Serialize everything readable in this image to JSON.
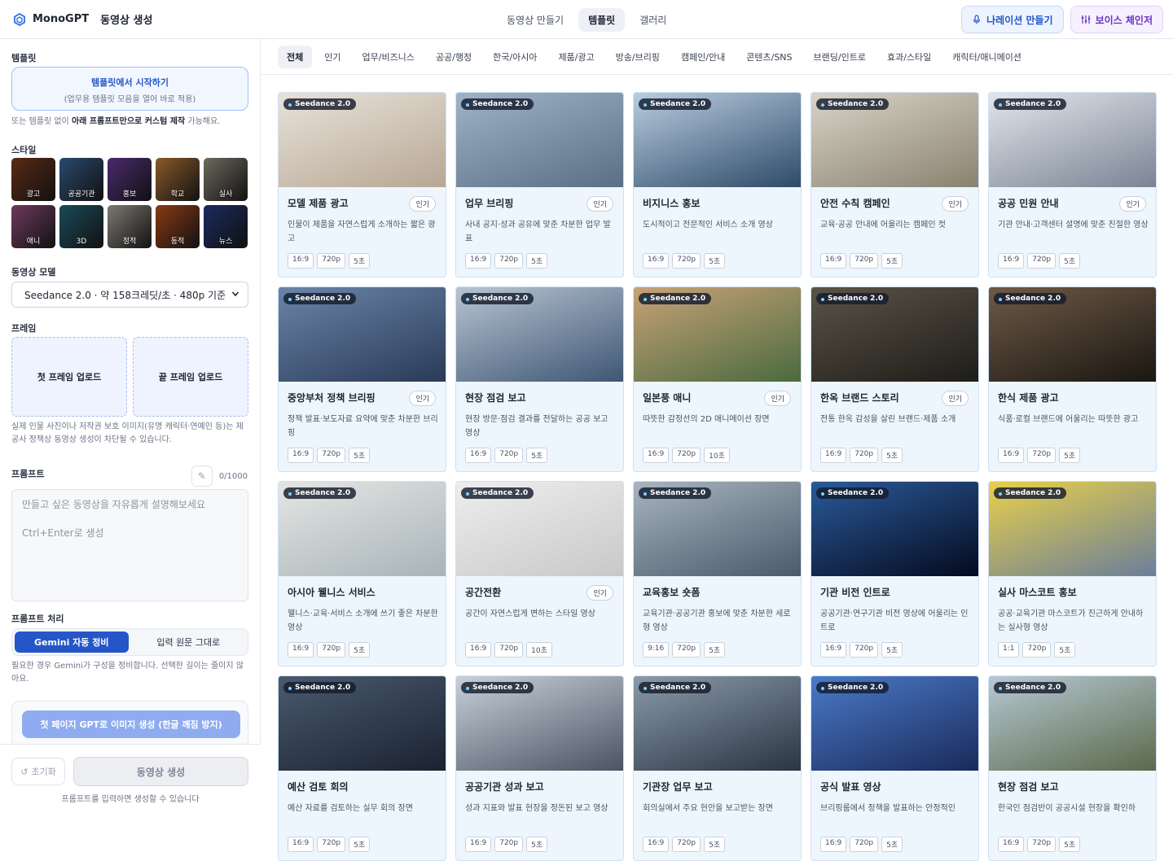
{
  "app": {
    "brand": "MonoGPT",
    "page": "동영상 생성"
  },
  "nav": {
    "tabs": [
      "동영상 만들기",
      "템플릿",
      "갤러리"
    ],
    "active": 1
  },
  "actions": {
    "narration": "나레이션 만들기",
    "voice": "보이스 체인저"
  },
  "sidebar": {
    "template_label": "템플릿",
    "template_start": "템플릿에서 시작하기",
    "template_start_sub": "(업무용 템플릿 모음을 열어 바로 적용)",
    "template_hint_pre": "또는 템플릿 없이 ",
    "template_hint_bold": "아래 프롬프트만으로 커스텀 제작",
    "template_hint_post": " 가능해요.",
    "style_label": "스타일",
    "styles": [
      {
        "name": "광고",
        "color": "#5a2a14"
      },
      {
        "name": "공공기관",
        "color": "#2a4a6e"
      },
      {
        "name": "홍보",
        "color": "#4a2a6e"
      },
      {
        "name": "학교",
        "color": "#8a5a2a"
      },
      {
        "name": "실사",
        "color": "#6e6a5e"
      },
      {
        "name": "애니",
        "color": "#6e3a5e"
      },
      {
        "name": "3D",
        "color": "#1a4a5a"
      },
      {
        "name": "정적",
        "color": "#7e7a72"
      },
      {
        "name": "동적",
        "color": "#8a3a14"
      },
      {
        "name": "뉴스",
        "color": "#1a2a5e"
      }
    ],
    "model_label": "동영상 모델",
    "model_value": "Seedance 2.0 · 약 158크레딧/초 · 480p 기준",
    "frame_label": "프레임",
    "first_frame": "첫 프레임 업로드",
    "last_frame": "끝 프레임 업로드",
    "frame_hint": "실제 인물 사진이나 저작권 보호 이미지(유명 캐릭터·연예인 등)는 제공사 정책상 동영상 생성이 차단될 수 있습니다.",
    "prompt_label": "프롬프트",
    "prompt_count": "0/1000",
    "prompt_placeholder_1": "만들고 싶은 동영상을 자유롭게 설명해보세요",
    "prompt_placeholder_2": "Ctrl+Enter로 생성",
    "processing_label": "프롬프트 처리",
    "processing_options": [
      "Gemini 자동 정비",
      "입력 원문 그대로"
    ],
    "processing_active": 0,
    "processing_hint": "필요한 경우 Gemini가 구성을 정비합니다. 선택한 길이는 줄이지 않아요.",
    "gpt_button": "첫 페이지 GPT로 이미지 생성 (한글 깨짐 방지)",
    "reset": "초기화",
    "generate": "동영상 생성",
    "generate_hint": "프롬프트를 입력하면 생성할 수 있습니다"
  },
  "categories": [
    "전체",
    "인기",
    "업무/비즈니스",
    "공공/행정",
    "한국/아시아",
    "제품/광고",
    "방송/브리핑",
    "캠페인/안내",
    "콘텐츠/SNS",
    "브랜딩/인트로",
    "효과/스타일",
    "캐릭터/애니메이션"
  ],
  "category_active": 0,
  "model_badge": "Seedance 2.0",
  "hot_label": "인기",
  "cards": [
    {
      "title": "모델 제품 광고",
      "hot": true,
      "desc": "인물이 제품을 자연스럽게 소개하는 짧은 광고",
      "tags": [
        "16:9",
        "720p",
        "5초"
      ],
      "c1": "#e8e2da",
      "c2": "#b7a794"
    },
    {
      "title": "업무 브리핑",
      "hot": true,
      "desc": "사내 공지·성과 공유에 맞춘 차분한 업무 발표",
      "tags": [
        "16:9",
        "720p",
        "5초"
      ],
      "c1": "#9fb3c8",
      "c2": "#5a6e84"
    },
    {
      "title": "비지니스 홍보",
      "hot": false,
      "desc": "도시적이고 전문적인 서비스 소개 영상",
      "tags": [
        "16:9",
        "720p",
        "5초"
      ],
      "c1": "#b9cde0",
      "c2": "#2e4a68"
    },
    {
      "title": "안전 수칙 캠페인",
      "hot": true,
      "desc": "교육·공공 안내에 어울리는 캠페인 컷",
      "tags": [
        "16:9",
        "720p",
        "5초"
      ],
      "c1": "#d8d4c8",
      "c2": "#8a8270"
    },
    {
      "title": "공공 민원 안내",
      "hot": true,
      "desc": "기관 안내·고객센터 설명에 맞춘 친절한 영상",
      "tags": [
        "16:9",
        "720p",
        "5초"
      ],
      "c1": "#e2e6ec",
      "c2": "#7a8494"
    },
    {
      "title": "중앙부처 정책 브리핑",
      "hot": true,
      "desc": "정책 발표·보도자료 요약에 맞춘 차분한 브리핑",
      "tags": [
        "16:9",
        "720p",
        "5초"
      ],
      "c1": "#6a84a8",
      "c2": "#2a3a58"
    },
    {
      "title": "현장 점검 보고",
      "hot": false,
      "desc": "현장 방문·점검 결과를 전달하는 공공 보고 영상",
      "tags": [
        "16:9",
        "720p",
        "5초"
      ],
      "c1": "#b8c4d2",
      "c2": "#3e5674"
    },
    {
      "title": "일본풍 애니",
      "hot": true,
      "desc": "따뜻한 감정선의 2D 애니메이션 장면",
      "tags": [
        "16:9",
        "720p",
        "10초"
      ],
      "c1": "#c8a278",
      "c2": "#4a6a3e"
    },
    {
      "title": "한옥 브랜드 스토리",
      "hot": true,
      "desc": "전통 한옥 감성을 살린 브랜드·제품 소개",
      "tags": [
        "16:9",
        "720p",
        "5초"
      ],
      "c1": "#5a5448",
      "c2": "#1e1c18"
    },
    {
      "title": "한식 제품 광고",
      "hot": false,
      "desc": "식품·로컬 브랜드에 어울리는 따뜻한 광고",
      "tags": [
        "16:9",
        "720p",
        "5초"
      ],
      "c1": "#6e5a46",
      "c2": "#1a1612"
    },
    {
      "title": "아시아 웰니스 서비스",
      "hot": false,
      "desc": "웰니스·교육·서비스 소개에 쓰기 좋은 차분한 영상",
      "tags": [
        "16:9",
        "720p",
        "5초"
      ],
      "c1": "#e4e6e4",
      "c2": "#a8b4b8"
    },
    {
      "title": "공간전환",
      "hot": true,
      "desc": "공간이 자연스럽게 변하는 스타일 영상",
      "tags": [
        "16:9",
        "720p",
        "10초"
      ],
      "c1": "#eeeeee",
      "c2": "#c8c8c8"
    },
    {
      "title": "교육홍보 숏폼",
      "hot": false,
      "desc": "교육기관·공공기관 홍보에 맞춘 차분한 세로형 영상",
      "tags": [
        "9:16",
        "720p",
        "5초"
      ],
      "c1": "#a8b4c0",
      "c2": "#4a5a6a"
    },
    {
      "title": "기관 비전 인트로",
      "hot": false,
      "desc": "공공기관·연구기관 비전 영상에 어울리는 인트로",
      "tags": [
        "16:9",
        "720p",
        "5초"
      ],
      "c1": "#2a5a9a",
      "c2": "#050a1e"
    },
    {
      "title": "실사 마스코트 홍보",
      "hot": false,
      "desc": "공공·교육기관 마스코트가 친근하게 안내하는 실사형 영상",
      "tags": [
        "1:1",
        "720p",
        "5초"
      ],
      "c1": "#e8d04a",
      "c2": "#6a7e9a"
    },
    {
      "title": "예산 검토 회의",
      "hot": false,
      "desc": "예산 자료를 검토하는 실무 회의 장면",
      "tags": [
        "16:9",
        "720p",
        "5초"
      ],
      "c1": "#4a5a6e",
      "c2": "#1a2230"
    },
    {
      "title": "공공기관 성과 보고",
      "hot": false,
      "desc": "성과 지표와 발표 현장을 정돈된 보고 영상",
      "tags": [
        "16:9",
        "720p",
        "5초"
      ],
      "c1": "#c8d0da",
      "c2": "#4a5462"
    },
    {
      "title": "기관장 업무 보고",
      "hot": false,
      "desc": "회의실에서 주요 현안을 보고받는 장면",
      "tags": [
        "16:9",
        "720p",
        "5초"
      ],
      "c1": "#8a9aaa",
      "c2": "#2a3442"
    },
    {
      "title": "공식 발표 영상",
      "hot": false,
      "desc": "브리핑룸에서 정책을 발표하는 안정적인",
      "tags": [
        "16:9",
        "720p",
        "5초"
      ],
      "c1": "#4a7ac8",
      "c2": "#1a2a5a"
    },
    {
      "title": "현장 점검 보고",
      "hot": false,
      "desc": "한국인 점검반이 공공시설 현장을 확인하",
      "tags": [
        "16:9",
        "720p",
        "5초"
      ],
      "c1": "#b8c8d4",
      "c2": "#5a6a4a"
    }
  ]
}
